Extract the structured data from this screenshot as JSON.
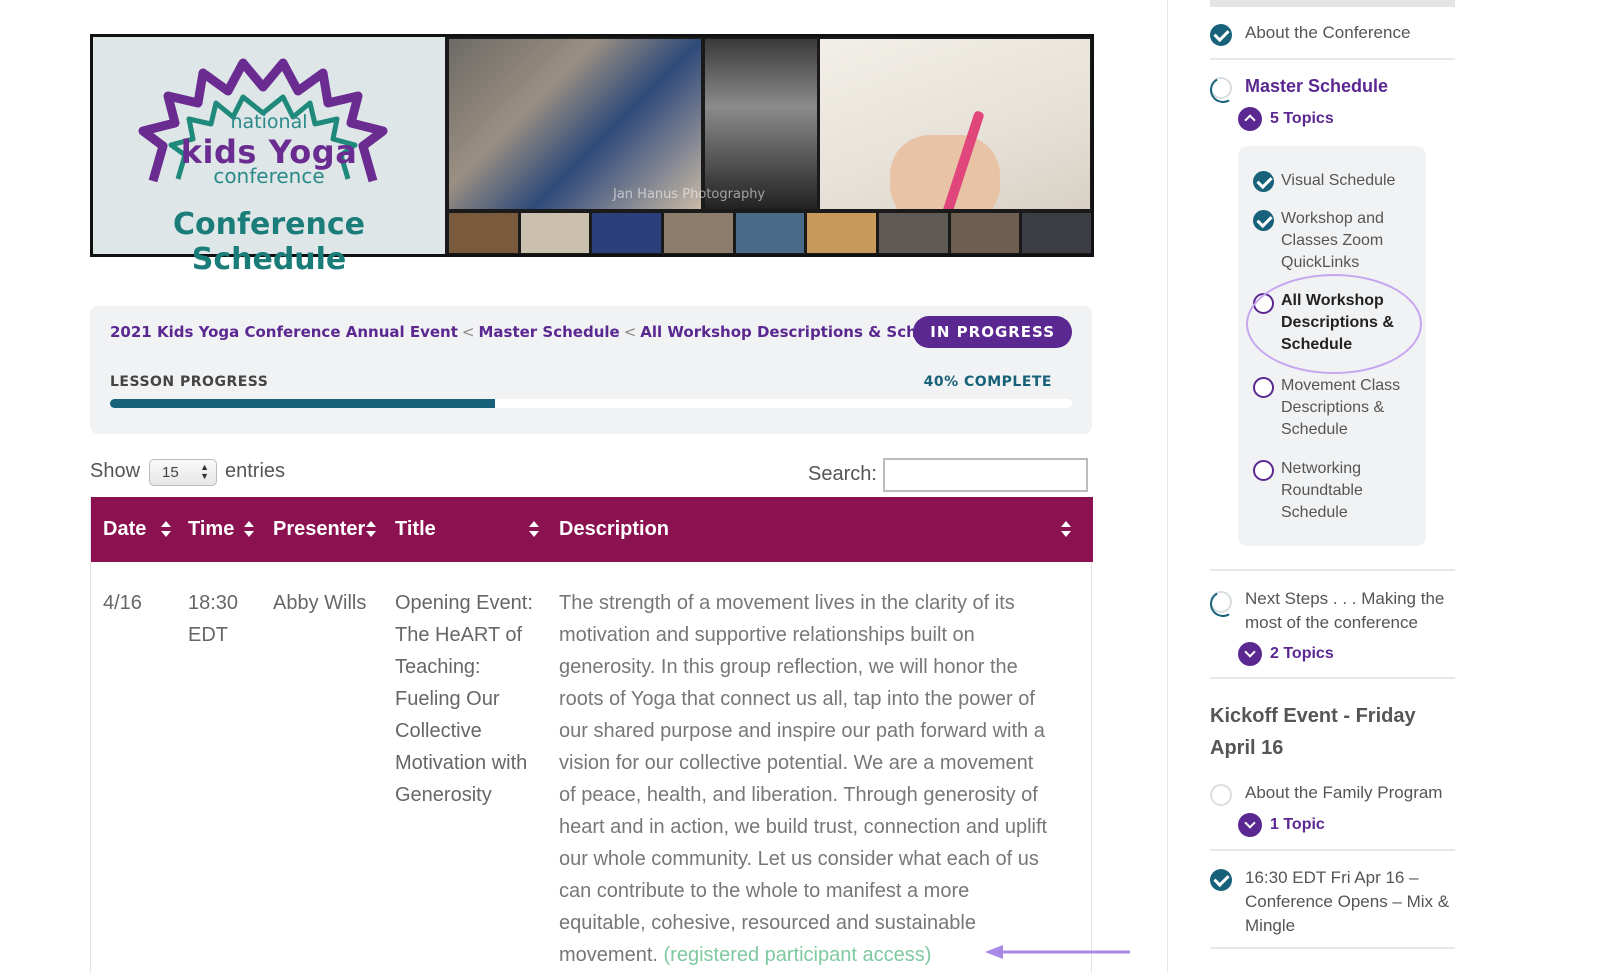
{
  "banner": {
    "logo_national": "national",
    "logo_kids_yoga": "kids Yoga",
    "logo_conference": "conference",
    "title": "Conference Schedule",
    "watermark": "Jan Hanus Photography"
  },
  "lesson": {
    "breadcrumb": [
      "2021 Kids Yoga Conference Annual Event",
      "Master Schedule",
      "All Workshop Descriptions & Schedule"
    ],
    "breadcrumb_separator": "<",
    "status": "IN PROGRESS",
    "progress_label": "LESSON PROGRESS",
    "progress_text": "40% COMPLETE",
    "progress_fraction": 0.4
  },
  "table_controls": {
    "show_label": "Show",
    "page_size": "15",
    "entries_label": "entries",
    "search_label": "Search:",
    "search_value": ""
  },
  "table": {
    "columns": [
      "Date",
      "Time",
      "Presenter",
      "Title",
      "Description"
    ],
    "rows": [
      {
        "date": "4/16",
        "time_line1": "18:30",
        "time_line2": "EDT",
        "presenter": "Abby Wills",
        "title_lines": [
          "Opening Event:",
          "The HeART of",
          "Teaching:",
          "Fueling Our",
          "Collective",
          "Motivation with",
          "Generosity"
        ],
        "description_lines": [
          "The strength of a movement lives in the clarity of its",
          "motivation and supportive relationships built on",
          "generosity. In this group reflection, we will honor the",
          "roots of Yoga that connect us all, tap into the power of",
          "our shared purpose and inspire our path forward with a",
          "vision for our collective potential. We are a movement",
          "of peace, health, and liberation. Through generosity of",
          "heart and in action, we build trust, connection and uplift",
          "our whole community. Let us consider what each of us",
          "can contribute to the whole to manifest a more",
          "equitable, cohesive, resourced and sustainable",
          "movement."
        ],
        "access_link": "(registered participant access)"
      }
    ]
  },
  "sidebar": {
    "items": [
      {
        "label": "About the Conference",
        "status": "complete"
      },
      {
        "label": "Master Schedule",
        "status": "in-progress",
        "topics_label": "5 Topics",
        "expanded": true
      },
      {
        "label_line1": "Next Steps . . . Making the",
        "label_line2": "most of the conference",
        "status": "in-progress",
        "topics_label": "2 Topics"
      },
      {
        "label": "About the Family Program",
        "status": "not-started",
        "topics_label": "1 Topic"
      },
      {
        "label_line1": "16:30 EDT Fri Apr 16 –",
        "label_line2": "Conference Opens – Mix &",
        "label_line3": "Mingle",
        "status": "complete"
      }
    ],
    "topics": [
      {
        "lines": [
          "Visual Schedule"
        ],
        "status": "complete"
      },
      {
        "lines": [
          "Workshop and",
          "Classes Zoom",
          "QuickLinks"
        ],
        "status": "complete"
      },
      {
        "lines": [
          "All Workshop",
          "Descriptions &",
          "Schedule"
        ],
        "status": "current"
      },
      {
        "lines": [
          "Movement Class",
          "Descriptions &",
          "Schedule"
        ],
        "status": "not-started"
      },
      {
        "lines": [
          "Networking",
          "Roundtable",
          "Schedule"
        ],
        "status": "not-started"
      }
    ],
    "section_heading_line1": "Kickoff Event - Friday",
    "section_heading_line2": "April 16"
  },
  "colors": {
    "brand_purple": "#5b2891",
    "table_header": "#8b1150",
    "progress_teal": "#17627a",
    "access_link": "#7ec9a0",
    "annotation": "#c5a6ef"
  },
  "icons": [
    "check-circle-icon",
    "partial-progress-icon",
    "empty-circle-icon",
    "chevron-up-icon",
    "chevron-down-icon",
    "sort-icon",
    "arrow-annotation-icon"
  ]
}
